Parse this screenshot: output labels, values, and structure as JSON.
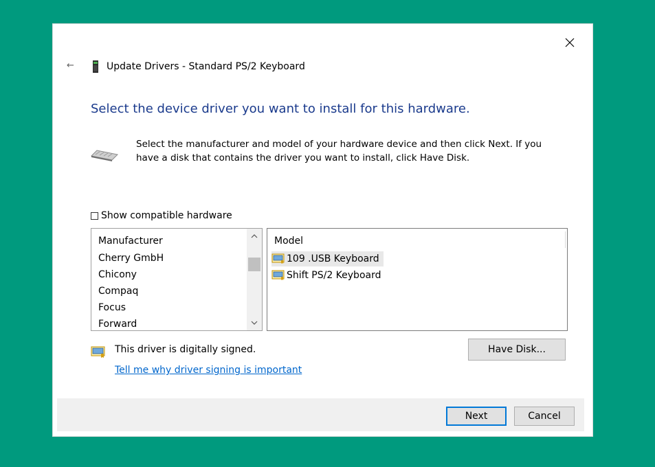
{
  "window": {
    "title": "Update Drivers - Standard PS/2 Keyboard",
    "back_glyph": "←",
    "close_glyph": "✕"
  },
  "heading": "Select the device driver you want to install for this hardware.",
  "description": "Select the manufacturer and model of your hardware device and then click Next. If you have a disk that contains the driver you want to install, click Have Disk.",
  "compatible_checkbox": {
    "label": "Show compatible hardware",
    "checked": false
  },
  "manufacturer_list": {
    "header": "Manufacturer",
    "items": [
      "Cherry GmbH",
      "Chicony",
      "Compaq",
      "Focus",
      "Forward"
    ]
  },
  "model_list": {
    "header": "Model",
    "items": [
      {
        "label": "109 .USB Keyboard",
        "selected": true
      },
      {
        "label": "Shift PS/2 Keyboard",
        "selected": false
      }
    ]
  },
  "signature": {
    "status_text": "This driver is digitally signed.",
    "link_text": "Tell me why driver signing is important"
  },
  "buttons": {
    "have_disk": "Have Disk...",
    "next": "Next",
    "cancel": "Cancel"
  },
  "colors": {
    "background": "#009a7e",
    "heading": "#1a3a8c",
    "link": "#0066cc",
    "default_button_border": "#0078d7"
  },
  "icons": {
    "title": "keyboard-device-icon",
    "description": "keyboard-icon",
    "model_item": "signed-driver-icon",
    "signed_status": "signed-driver-icon"
  }
}
